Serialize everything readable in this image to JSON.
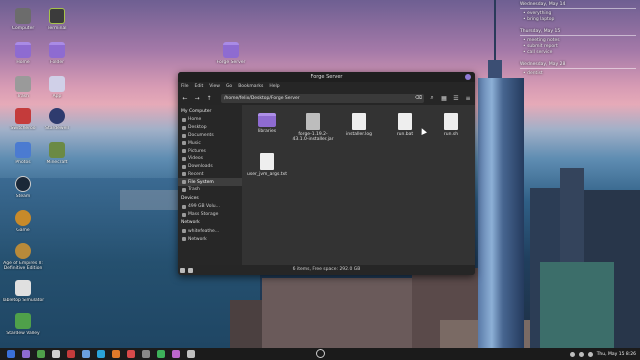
{
  "desktop": {
    "icons": [
      {
        "label": "Computer",
        "color": "#6c6c6c"
      },
      {
        "label": "Terminal",
        "color": "#3b3b3b"
      },
      {
        "label": "Home",
        "color": "#8e6bd1"
      },
      {
        "label": "Folder",
        "color": "#8e6bd1"
      },
      {
        "label": "Trash",
        "color": "#9a9a9a"
      },
      {
        "label": "App",
        "color": "#d0d0e8"
      },
      {
        "label": "Switcheroo",
        "color": "#c43b3b"
      },
      {
        "label": "Stardewell",
        "color": "#2e3b6e"
      },
      {
        "label": "Photos",
        "color": "#4b7bd1"
      },
      {
        "label": "Minecraft",
        "color": "#6b8a45"
      },
      {
        "label": "Steam",
        "color": "#1b2838"
      },
      {
        "label": "Game",
        "color": "#c78a2a"
      },
      {
        "label": "Age of Empires II: Definitive Edition",
        "color": "#b88a3a"
      },
      {
        "label": "Tabletop Simulator",
        "color": "#e0e0e0"
      },
      {
        "label": "Stardew Valley",
        "color": "#4fa04a"
      },
      {
        "label": "Forge Server",
        "color": "#8e6bd1"
      }
    ]
  },
  "widget": {
    "sections": [
      {
        "title": "Wednesday, May 14",
        "rows": [
          "• everything",
          "• bring laptop"
        ]
      },
      {
        "title": "Thursday, May 15",
        "rows": [
          "• meeting notes",
          "• submit report",
          "• call service"
        ]
      },
      {
        "title": "Wednesday, May 28",
        "rows": [
          "• dentist"
        ]
      }
    ]
  },
  "window": {
    "title": "Forge Server",
    "menu": [
      "File",
      "Edit",
      "View",
      "Go",
      "Bookmarks",
      "Help"
    ],
    "path": "/home/felix/Desktop/Forge Server",
    "status": "6 items, Free space: 292.0 GB",
    "sidebar": {
      "my_computer": "My Computer",
      "places": [
        "Home",
        "Desktop",
        "Documents",
        "Music",
        "Pictures",
        "Videos",
        "Downloads",
        "Recent",
        "File System",
        "Trash"
      ],
      "devices_head": "Devices",
      "devices": [
        "499 GB Volu...",
        "Mass Storage"
      ],
      "network_head": "Network",
      "network": [
        "whitefeathe...",
        "Network"
      ]
    },
    "files": [
      {
        "name": "libraries",
        "type": "folder"
      },
      {
        "name": "forge-1.19.2-43.1.0-installer.jar",
        "type": "jar"
      },
      {
        "name": "installer.log",
        "type": "text"
      },
      {
        "name": "run.bat",
        "type": "text"
      },
      {
        "name": "run.sh",
        "type": "text"
      },
      {
        "name": "user_jvm_args.txt",
        "type": "text"
      }
    ]
  },
  "taskbar": {
    "clock": "Thu, May 15  8:26",
    "app_colors": [
      "#3a6fd8",
      "#8e6bd1",
      "#4fa04a",
      "#d0d0d0",
      "#c43b3b",
      "#6aa0e0",
      "#2aa3d8",
      "#e07a2a",
      "#d84a4a",
      "#888888",
      "#3db25a",
      "#bb66cc",
      "#c0c0c0"
    ]
  }
}
